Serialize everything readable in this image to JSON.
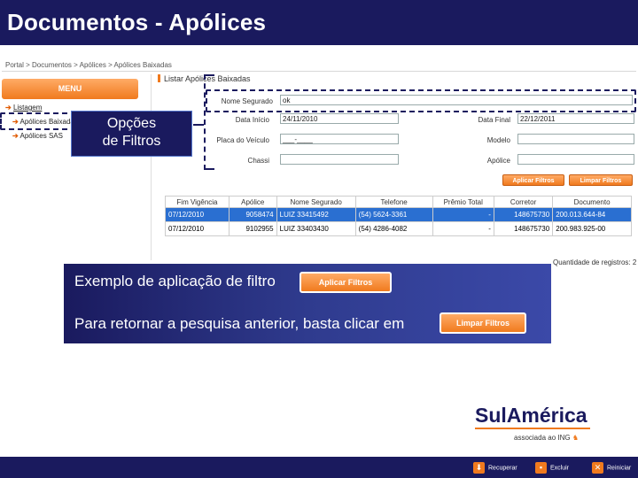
{
  "slide": {
    "title": "Documentos - Apólices"
  },
  "app": {
    "breadcrumb": "Portal > Documentos > Apólices > Apólices Baixadas",
    "menu_button": "MENU",
    "nav": {
      "section": "Listagem",
      "items": [
        "Apólices Baixadas",
        "Apólices SAS"
      ]
    },
    "panel_title": "Listar Apólices Baixadas",
    "filters": {
      "nome_segurado": {
        "label": "Nome Segurado",
        "value": "ok"
      },
      "data_inicio": {
        "label": "Data Início",
        "value": "24/11/2010"
      },
      "data_final": {
        "label": "Data Final",
        "value": "22/12/2011"
      },
      "placa_modelo": {
        "label": "Placa do Veículo",
        "value": "___-____"
      },
      "modelo": {
        "label": "Modelo",
        "value": ""
      },
      "chassi": {
        "label": "Chassi",
        "value": ""
      },
      "apolice": {
        "label": "Apólice",
        "value": ""
      }
    },
    "buttons": {
      "apply": "Aplicar Filtros",
      "clear": "Limpar Filtros"
    },
    "table": {
      "headers": [
        "Fim Vigência",
        "Apólice",
        "Nome Segurado",
        "Telefone",
        "Prêmio Total",
        "Corretor",
        "Documento"
      ],
      "rows": [
        [
          "07/12/2010",
          "9058474",
          "LUIZ 33415492",
          "(54) 5624-3361",
          "-",
          "148675730",
          "200.013.644-84"
        ],
        [
          "07/12/2010",
          "9102955",
          "LUIZ 33403430",
          "(54) 4286-4082",
          "-",
          "148675730",
          "200.983.925-00"
        ]
      ]
    },
    "record_count": "Quantidade de registros: 2"
  },
  "callout": {
    "line1": "Opções",
    "line2": "de Filtros"
  },
  "example": {
    "text1": "Exemplo de aplicação de filtro",
    "text2": "Para retornar a pesquisa anterior, basta clicar em",
    "apply_label": "Aplicar Filtros",
    "clear_label": "Limpar Filtros"
  },
  "brand": {
    "logo": "SulAmérica",
    "assoc": "associada ao ING"
  },
  "footer": {
    "items": [
      "Recuperar",
      "Excluir",
      "Reiniciar"
    ]
  },
  "colors": {
    "navy": "#1a1a5e",
    "orange": "#f07a1e",
    "selected_row": "#2a6fd1"
  }
}
